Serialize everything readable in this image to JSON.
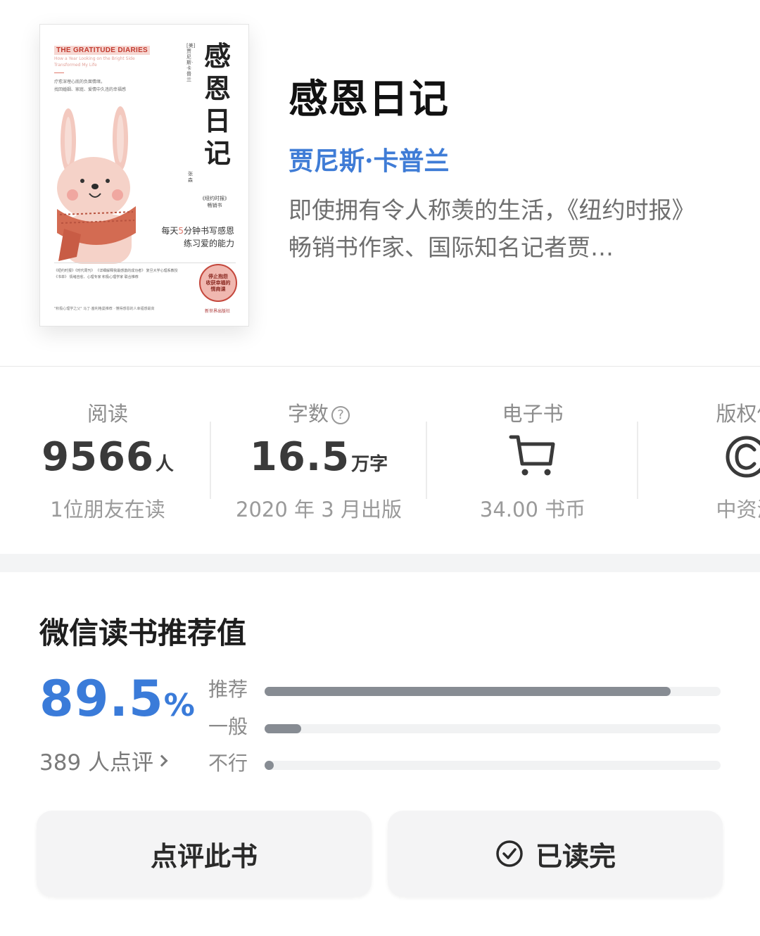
{
  "cover": {
    "en_title": "THE GRATITUDE DIARIES",
    "en_subtitle": "How a Year Looking on the Bright Side Transformed My Life",
    "desc": "疗愈深埋心底的负面情绪，\n找回婚姻、家庭、爱情中久违的幸福感",
    "title": "感恩日记",
    "author": "[美]贾尼斯·卡普兰",
    "translator": "张森",
    "nyt": "《纽约时报》\n畅销书",
    "slogan_pre": "每天",
    "slogan_num": "5",
    "slogan_post": "分钟书写感恩\n练习爱的能力",
    "recs": "《纽约时报》《时代周刊》 《详细解释我最感激的成功者》 复旦大学心理系教授\n《书单》 情绪自愈、心理专家 积极心理学家 联合推荐",
    "stamp": "停止抱怨\n收获幸福的\n情商课",
    "bottom": "\"积极心理学之父\" 马丁·塞利格曼推荐 · 懂得感恩的人幸福感最高",
    "publisher": "新世界出版社"
  },
  "book": {
    "title": "感恩日记",
    "author": "贾尼斯·卡普兰",
    "intro": "即使拥有令人称羡的生活，《纽约时报》畅销书作家、国际知名记者贾…"
  },
  "stats": {
    "read": {
      "label": "阅读",
      "value": "9566",
      "unit": "人",
      "sub": "1位朋友在读"
    },
    "words": {
      "label": "字数",
      "help_icon": "?",
      "value": "16.5",
      "unit": "万字",
      "sub": "2020 年 3 月出版"
    },
    "ebook": {
      "label": "电子书",
      "icon": "cart-icon",
      "sub": "34.00 书币"
    },
    "copyright": {
      "label": "版权信",
      "icon": "copyright-icon",
      "sub": "中资海"
    }
  },
  "recommend": {
    "title": "微信读书推荐值",
    "score": "89.5",
    "percent_sign": "%",
    "count_text": "389 人点评",
    "bars": [
      {
        "label": "推荐",
        "fraction": 0.89
      },
      {
        "label": "一般",
        "fraction": 0.08
      },
      {
        "label": "不行",
        "fraction": 0.02
      }
    ]
  },
  "actions": {
    "review_label": "点评此书",
    "done_label": "已读完",
    "done_icon": "check-circle-icon"
  },
  "colors": {
    "accent": "#3a7bd9",
    "author": "#3f7cd6",
    "bar_fill": "#878c93",
    "bar_track": "#f1f2f3"
  }
}
